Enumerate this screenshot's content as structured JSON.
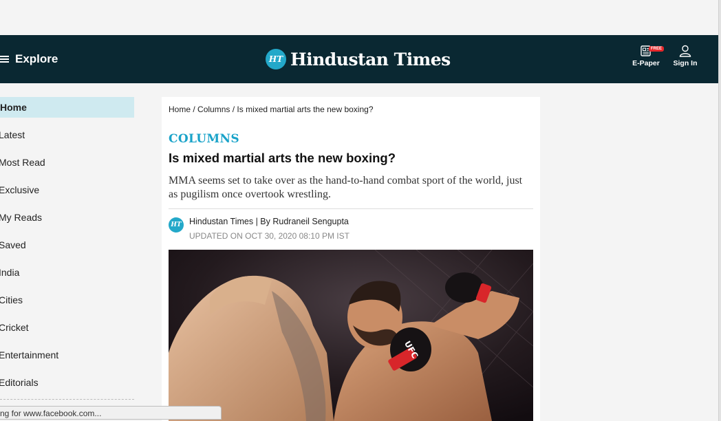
{
  "header": {
    "explore_label": "Explore",
    "logo_badge": "HT",
    "logo_text": "Hindustan Times",
    "epaper_label": "E-Paper",
    "epaper_badge": "FREE",
    "signin_label": "Sign In",
    "background_color": "#0a2832",
    "accent_color": "#23a8c9"
  },
  "sidebar": {
    "items": [
      {
        "label": "Home",
        "active": true
      },
      {
        "label": "Latest"
      },
      {
        "label": "Most Read"
      },
      {
        "label": "Exclusive"
      },
      {
        "label": "My Reads"
      },
      {
        "label": "Saved"
      },
      {
        "label": "India"
      },
      {
        "label": "Cities"
      },
      {
        "label": "Cricket"
      },
      {
        "label": "Entertainment"
      },
      {
        "label": "Editorials"
      }
    ],
    "active_color": "#cfeaf0"
  },
  "article": {
    "breadcrumb": {
      "home": "Home",
      "sep1": " / ",
      "section": "Columns",
      "sep2": " / ",
      "current": "Is mixed martial arts the new boxing?"
    },
    "section_label": "COLUMNS",
    "headline": "Is mixed martial arts the new boxing?",
    "summary": "MMA seems set to take over as the hand-to-hand combat sport of the world, just as pugilism once overtook wrestling.",
    "byline_badge": "HT",
    "byline_source": "Hindustan Times",
    "byline_sep": " | By ",
    "byline_author": "Rudraneil Sengupta",
    "updated": "UPDATED ON OCT 30, 2020 08:10 PM IST",
    "section_color": "#1aa3c9"
  },
  "status_bar": {
    "text": "ng for www.facebook.com..."
  }
}
